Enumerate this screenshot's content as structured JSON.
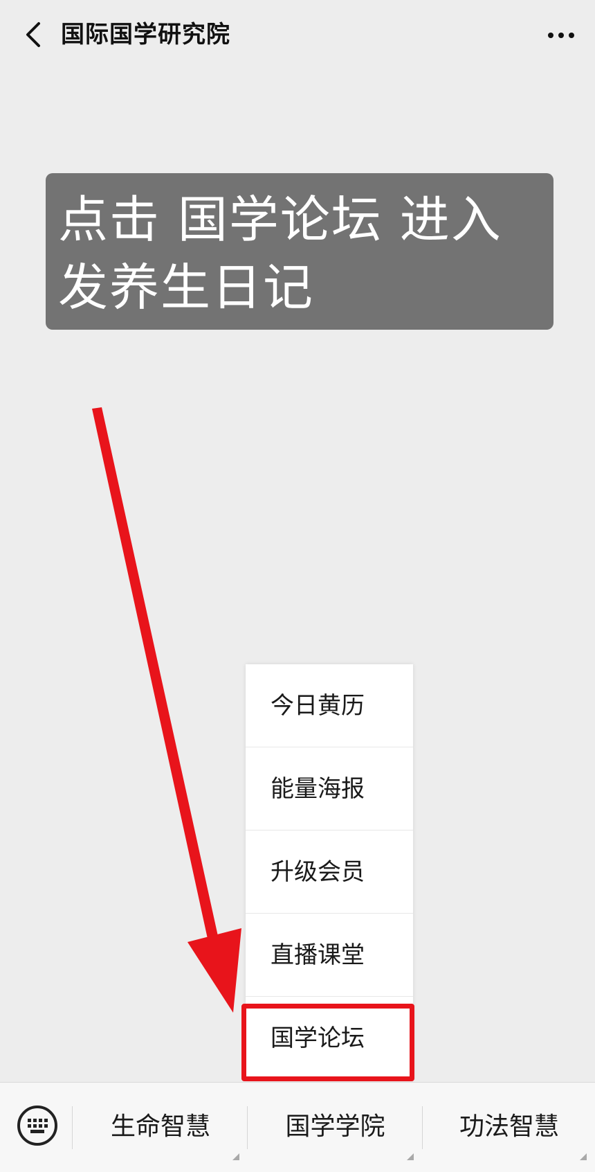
{
  "header": {
    "back_icon": "chevron-left-icon",
    "title": "国际国学研究院",
    "more_icon": "more-dots-icon"
  },
  "hint": {
    "text": "点击 国学论坛 进入发养生日记"
  },
  "annotation": {
    "arrow_color": "#e8141b",
    "highlight_color": "#e8141b"
  },
  "submenu": {
    "items": [
      {
        "label": "今日黄历"
      },
      {
        "label": "能量海报"
      },
      {
        "label": "升级会员"
      },
      {
        "label": "直播课堂"
      },
      {
        "label": "国学论坛"
      }
    ]
  },
  "bottom_menu": {
    "keyboard_icon": "keyboard-icon",
    "tabs": [
      {
        "label": "生命智慧"
      },
      {
        "label": "国学学院"
      },
      {
        "label": "功法智慧"
      }
    ]
  }
}
